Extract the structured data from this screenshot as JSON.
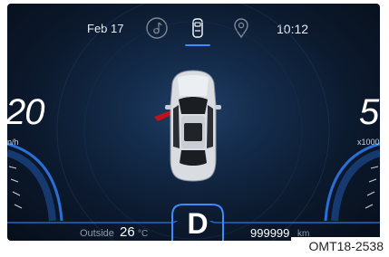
{
  "header": {
    "date": "Feb 17",
    "time": "10:12"
  },
  "icons": {
    "left": "music-note-icon",
    "center": "car-front-icon",
    "right": "location-pin-icon"
  },
  "speedometer": {
    "value": "20",
    "unit": "n/h"
  },
  "tachometer": {
    "value": "5.",
    "unit": "x1000"
  },
  "footer": {
    "outside_label": "Outside",
    "outside_temp": "26",
    "temp_unit": "°C",
    "gear": "D",
    "odometer": "999999",
    "odometer_unit": "km"
  },
  "caption": "OMT18-2538",
  "colors": {
    "accent": "#3d8bff",
    "door_open": "#c0121c",
    "background": "#0c1a2e"
  }
}
